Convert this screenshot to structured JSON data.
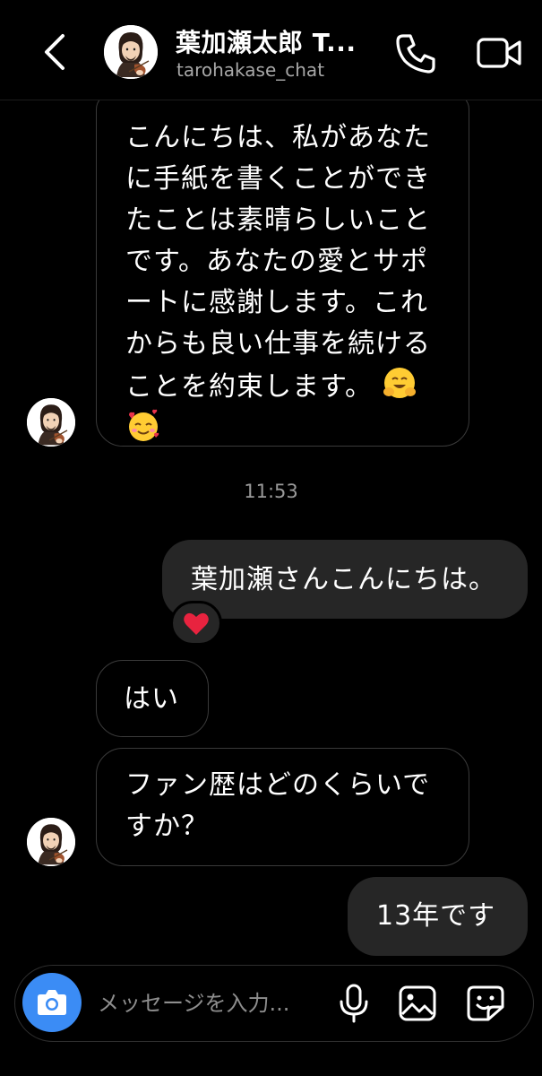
{
  "header": {
    "name": "葉加瀬太郎 T...",
    "handle": "tarohakase_chat",
    "back_icon": "chevron-left-icon",
    "call_icon": "phone-icon",
    "video_icon": "video-camera-icon"
  },
  "messages": [
    {
      "direction": "incoming",
      "text": "こんにちは、私があなたに手紙を書くことができたことは素晴らしいことです。あなたの愛とサポートに感謝します。これからも良い仕事を続けることを約束します。",
      "emojis": [
        "hugging-face-emoji",
        "smiling-face-with-hearts-emoji"
      ]
    },
    {
      "type": "timestamp",
      "text": "11:53"
    },
    {
      "direction": "outgoing",
      "text": "葉加瀬さんこんにちは。",
      "reaction": "red-heart-emoji"
    },
    {
      "direction": "incoming",
      "text": "はい"
    },
    {
      "direction": "incoming",
      "text": "ファン歴はどのくらいですか？"
    },
    {
      "direction": "outgoing",
      "text": "13年です"
    }
  ],
  "composer": {
    "placeholder": "メッセージを入力...",
    "camera_icon": "camera-icon",
    "mic_icon": "microphone-icon",
    "gallery_icon": "gallery-icon",
    "sticker_icon": "sticker-icon"
  },
  "colors": {
    "background": "#000000",
    "outgoing_bubble": "#262626",
    "incoming_border": "#3a3a3a",
    "camera_button": "#3b8cf5",
    "secondary_text": "#a8a8a8"
  }
}
